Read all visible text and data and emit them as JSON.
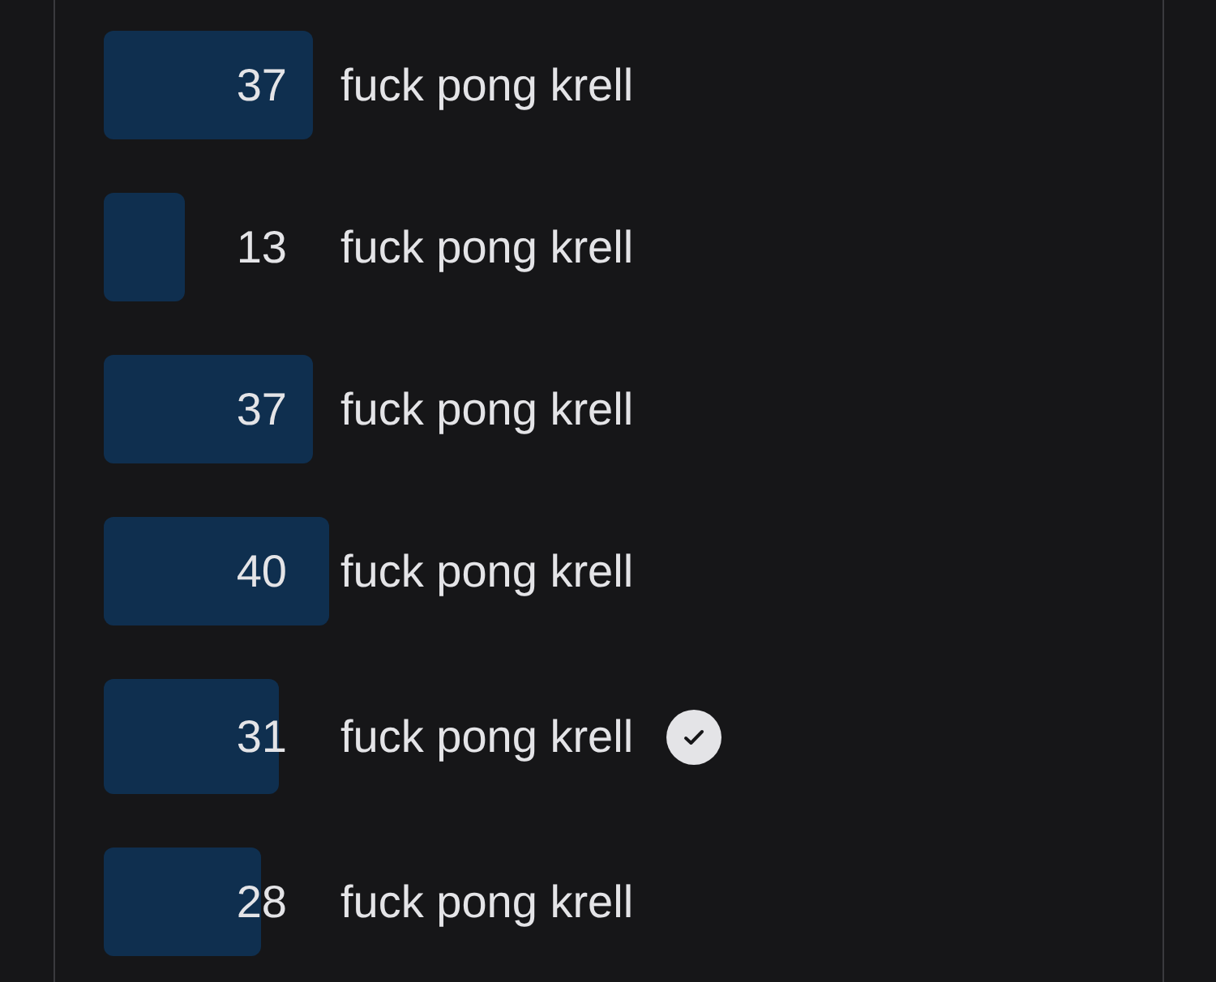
{
  "options": [
    {
      "votes": "37",
      "label": "fuck pong krell",
      "selected": false
    },
    {
      "votes": "13",
      "label": "fuck pong krell",
      "selected": false
    },
    {
      "votes": "37",
      "label": "fuck pong krell",
      "selected": false
    },
    {
      "votes": "40",
      "label": "fuck pong krell",
      "selected": false
    },
    {
      "votes": "31",
      "label": "fuck pong krell",
      "selected": true
    },
    {
      "votes": "28",
      "label": "fuck pong krell",
      "selected": false
    }
  ]
}
